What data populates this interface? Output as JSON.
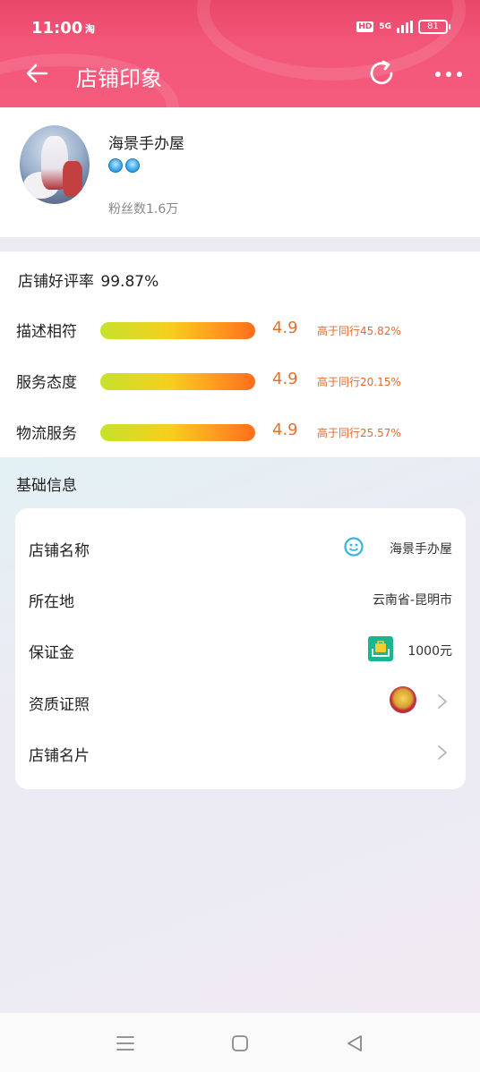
{
  "status_bar": {
    "time": "11:00",
    "app_icon": "淘",
    "hd": "HD",
    "network": "5G",
    "battery": "81"
  },
  "nav": {
    "title": "店铺印象",
    "icons": [
      "back-arrow-icon",
      "refresh-icon",
      "more-icon"
    ]
  },
  "shop": {
    "name": "海景手办屋",
    "fans_label": "粉丝数1.6万",
    "badge_count": 2
  },
  "ratings": {
    "good_rate_label": "店铺好评率",
    "good_rate_value": "99.87%",
    "items": [
      {
        "label": "描述相符",
        "score": "4.9",
        "compare": "高于同行45.82%"
      },
      {
        "label": "服务态度",
        "score": "4.9",
        "compare": "高于同行20.15%"
      },
      {
        "label": "物流服务",
        "score": "4.9",
        "compare": "高于同行25.57%"
      }
    ]
  },
  "basic_info": {
    "title": "基础信息",
    "rows": [
      {
        "key": "店铺名称",
        "value": "海景手办屋",
        "icon": "smile-icon"
      },
      {
        "key": "所在地",
        "value": "云南省-昆明市"
      },
      {
        "key": "保证金",
        "value": "1000元",
        "icon": "bag-icon"
      },
      {
        "key": "资质证照",
        "value": "",
        "icon": "emblem-icon"
      },
      {
        "key": "店铺名片",
        "value": ""
      }
    ]
  },
  "colors": {
    "header": "#f3587a",
    "score": "#e3702a",
    "bag": "#18b58e"
  }
}
